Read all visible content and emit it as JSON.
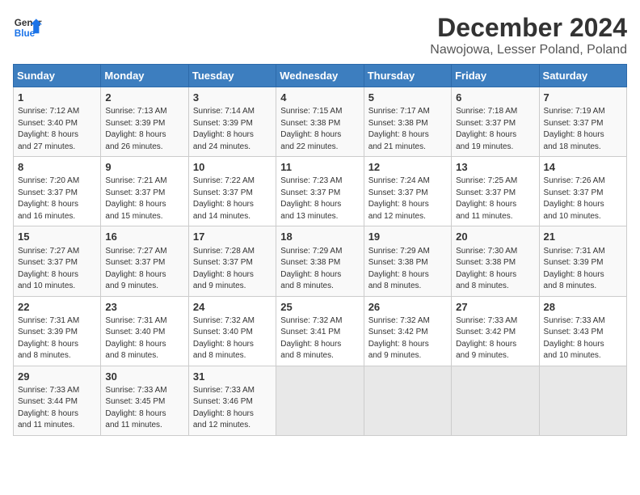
{
  "header": {
    "logo_line1": "General",
    "logo_line2": "Blue",
    "month": "December 2024",
    "location": "Nawojowa, Lesser Poland, Poland"
  },
  "weekdays": [
    "Sunday",
    "Monday",
    "Tuesday",
    "Wednesday",
    "Thursday",
    "Friday",
    "Saturday"
  ],
  "weeks": [
    [
      {
        "day": "1",
        "info": "Sunrise: 7:12 AM\nSunset: 3:40 PM\nDaylight: 8 hours\nand 27 minutes."
      },
      {
        "day": "2",
        "info": "Sunrise: 7:13 AM\nSunset: 3:39 PM\nDaylight: 8 hours\nand 26 minutes."
      },
      {
        "day": "3",
        "info": "Sunrise: 7:14 AM\nSunset: 3:39 PM\nDaylight: 8 hours\nand 24 minutes."
      },
      {
        "day": "4",
        "info": "Sunrise: 7:15 AM\nSunset: 3:38 PM\nDaylight: 8 hours\nand 22 minutes."
      },
      {
        "day": "5",
        "info": "Sunrise: 7:17 AM\nSunset: 3:38 PM\nDaylight: 8 hours\nand 21 minutes."
      },
      {
        "day": "6",
        "info": "Sunrise: 7:18 AM\nSunset: 3:37 PM\nDaylight: 8 hours\nand 19 minutes."
      },
      {
        "day": "7",
        "info": "Sunrise: 7:19 AM\nSunset: 3:37 PM\nDaylight: 8 hours\nand 18 minutes."
      }
    ],
    [
      {
        "day": "8",
        "info": "Sunrise: 7:20 AM\nSunset: 3:37 PM\nDaylight: 8 hours\nand 16 minutes."
      },
      {
        "day": "9",
        "info": "Sunrise: 7:21 AM\nSunset: 3:37 PM\nDaylight: 8 hours\nand 15 minutes."
      },
      {
        "day": "10",
        "info": "Sunrise: 7:22 AM\nSunset: 3:37 PM\nDaylight: 8 hours\nand 14 minutes."
      },
      {
        "day": "11",
        "info": "Sunrise: 7:23 AM\nSunset: 3:37 PM\nDaylight: 8 hours\nand 13 minutes."
      },
      {
        "day": "12",
        "info": "Sunrise: 7:24 AM\nSunset: 3:37 PM\nDaylight: 8 hours\nand 12 minutes."
      },
      {
        "day": "13",
        "info": "Sunrise: 7:25 AM\nSunset: 3:37 PM\nDaylight: 8 hours\nand 11 minutes."
      },
      {
        "day": "14",
        "info": "Sunrise: 7:26 AM\nSunset: 3:37 PM\nDaylight: 8 hours\nand 10 minutes."
      }
    ],
    [
      {
        "day": "15",
        "info": "Sunrise: 7:27 AM\nSunset: 3:37 PM\nDaylight: 8 hours\nand 10 minutes."
      },
      {
        "day": "16",
        "info": "Sunrise: 7:27 AM\nSunset: 3:37 PM\nDaylight: 8 hours\nand 9 minutes."
      },
      {
        "day": "17",
        "info": "Sunrise: 7:28 AM\nSunset: 3:37 PM\nDaylight: 8 hours\nand 9 minutes."
      },
      {
        "day": "18",
        "info": "Sunrise: 7:29 AM\nSunset: 3:38 PM\nDaylight: 8 hours\nand 8 minutes."
      },
      {
        "day": "19",
        "info": "Sunrise: 7:29 AM\nSunset: 3:38 PM\nDaylight: 8 hours\nand 8 minutes."
      },
      {
        "day": "20",
        "info": "Sunrise: 7:30 AM\nSunset: 3:38 PM\nDaylight: 8 hours\nand 8 minutes."
      },
      {
        "day": "21",
        "info": "Sunrise: 7:31 AM\nSunset: 3:39 PM\nDaylight: 8 hours\nand 8 minutes."
      }
    ],
    [
      {
        "day": "22",
        "info": "Sunrise: 7:31 AM\nSunset: 3:39 PM\nDaylight: 8 hours\nand 8 minutes."
      },
      {
        "day": "23",
        "info": "Sunrise: 7:31 AM\nSunset: 3:40 PM\nDaylight: 8 hours\nand 8 minutes."
      },
      {
        "day": "24",
        "info": "Sunrise: 7:32 AM\nSunset: 3:40 PM\nDaylight: 8 hours\nand 8 minutes."
      },
      {
        "day": "25",
        "info": "Sunrise: 7:32 AM\nSunset: 3:41 PM\nDaylight: 8 hours\nand 8 minutes."
      },
      {
        "day": "26",
        "info": "Sunrise: 7:32 AM\nSunset: 3:42 PM\nDaylight: 8 hours\nand 9 minutes."
      },
      {
        "day": "27",
        "info": "Sunrise: 7:33 AM\nSunset: 3:42 PM\nDaylight: 8 hours\nand 9 minutes."
      },
      {
        "day": "28",
        "info": "Sunrise: 7:33 AM\nSunset: 3:43 PM\nDaylight: 8 hours\nand 10 minutes."
      }
    ],
    [
      {
        "day": "29",
        "info": "Sunrise: 7:33 AM\nSunset: 3:44 PM\nDaylight: 8 hours\nand 11 minutes."
      },
      {
        "day": "30",
        "info": "Sunrise: 7:33 AM\nSunset: 3:45 PM\nDaylight: 8 hours\nand 11 minutes."
      },
      {
        "day": "31",
        "info": "Sunrise: 7:33 AM\nSunset: 3:46 PM\nDaylight: 8 hours\nand 12 minutes."
      },
      {
        "day": "",
        "info": ""
      },
      {
        "day": "",
        "info": ""
      },
      {
        "day": "",
        "info": ""
      },
      {
        "day": "",
        "info": ""
      }
    ]
  ]
}
